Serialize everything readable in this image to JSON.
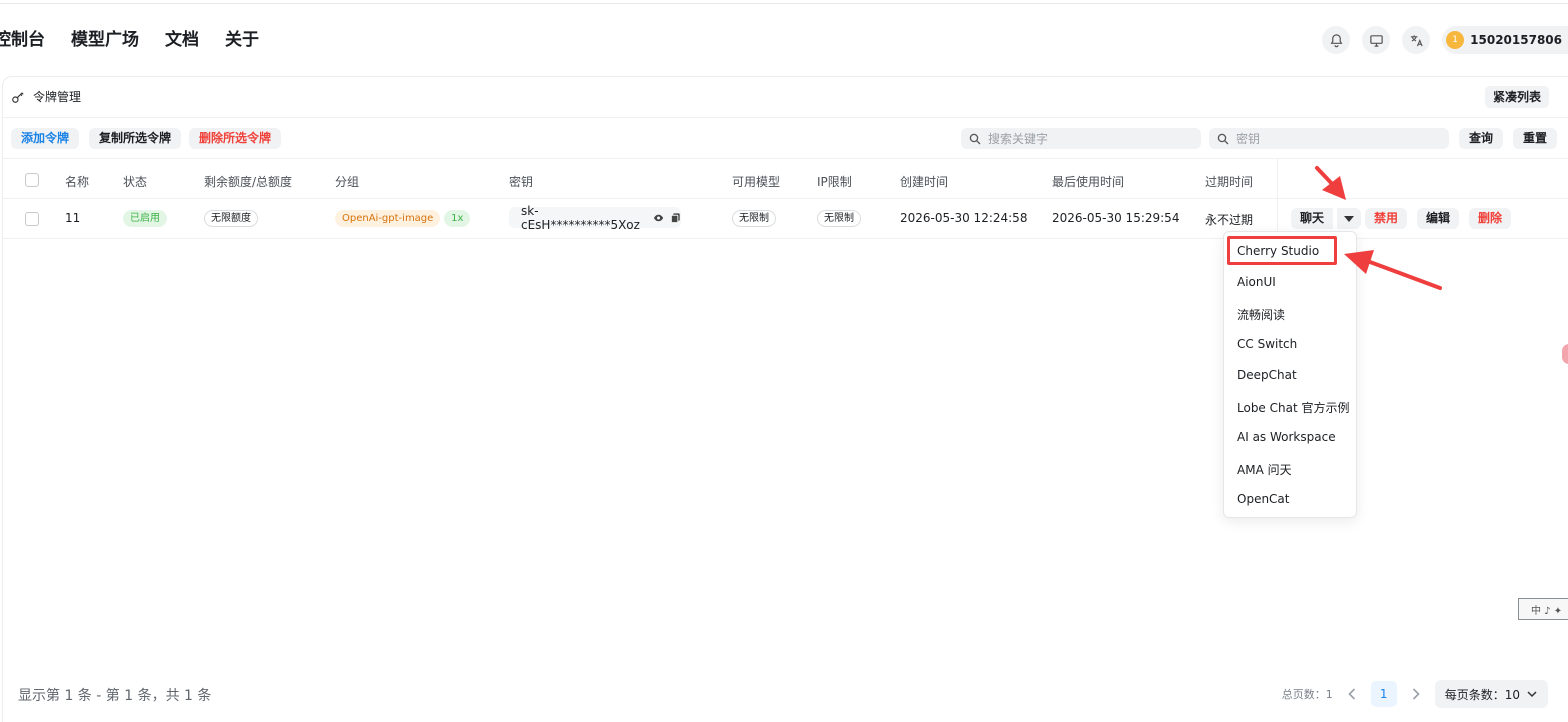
{
  "nav": {
    "items": [
      "控制台",
      "模型广场",
      "文档",
      "关于"
    ]
  },
  "header": {
    "icons": [
      "bell-icon",
      "monitor-icon",
      "translate-icon"
    ],
    "user_avatar_text": "1",
    "user_name": "15020157806"
  },
  "card": {
    "title": "令牌管理",
    "compact_label": "紧凑列表"
  },
  "toolbar": {
    "add_label": "添加令牌",
    "copy_label": "复制所选令牌",
    "delete_label": "删除所选令牌",
    "search_placeholder": "搜索关键字",
    "key_placeholder": "密钥",
    "query_label": "查询",
    "reset_label": "重置"
  },
  "table": {
    "headers": [
      "名称",
      "状态",
      "剩余额度/总额度",
      "分组",
      "密钥",
      "可用模型",
      "IP限制",
      "创建时间",
      "最后使用时间",
      "过期时间"
    ],
    "rows": [
      {
        "name": "11",
        "status": "已启用",
        "quota": "无限额度",
        "group": "OpenAi-gpt-image",
        "ratio": "1x",
        "key": "sk-cEsH**********5Xoz",
        "models": "无限制",
        "ip": "无限制",
        "created": "2026-05-30 12:24:58",
        "last_used": "2026-05-30 15:29:54",
        "expires": "永不过期",
        "actions": {
          "chat": "聊天",
          "disable": "禁用",
          "edit": "编辑",
          "delete": "删除"
        }
      }
    ]
  },
  "chat_dropdown": {
    "items": [
      "Cherry Studio",
      "AionUI",
      "流畅阅读",
      "CC Switch",
      "DeepChat",
      "Lobe Chat 官方示例",
      "AI as Workspace",
      "AMA 问天",
      "OpenCat"
    ]
  },
  "footer": {
    "summary": "显示第 1 条 - 第 1 条，共 1 条",
    "total_pages_label": "总页数：1",
    "current_page": "1",
    "page_size_label": "每页条数：10"
  },
  "colors": {
    "primary": "#1b82e6",
    "danger": "#f0413a",
    "success": "#3bb346",
    "annotation_red": "#ee3e3e"
  },
  "ime": {
    "text": "中 ♪ ✦"
  }
}
